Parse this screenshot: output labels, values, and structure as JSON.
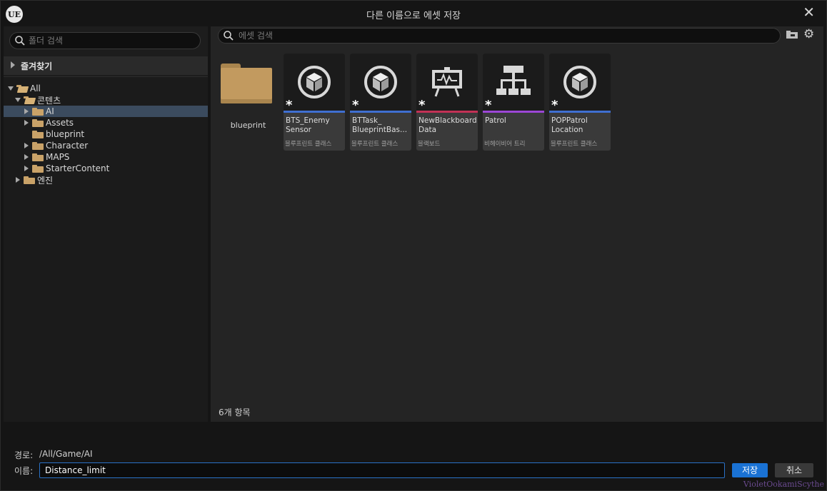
{
  "window": {
    "title": "다른 이름으로 에셋 저장",
    "logo": "UE"
  },
  "left": {
    "search_placeholder": "폴더 검색",
    "favorites_label": "즐겨찾기",
    "tree": [
      {
        "label": "All",
        "state": "open",
        "level": 0
      },
      {
        "label": "콘텐츠",
        "state": "open",
        "level": 1
      },
      {
        "label": "AI",
        "state": "closed",
        "level": 2,
        "selected": true
      },
      {
        "label": "Assets",
        "state": "closed",
        "level": 2
      },
      {
        "label": "blueprint",
        "state": "none",
        "level": 2
      },
      {
        "label": "Character",
        "state": "closed",
        "level": 2
      },
      {
        "label": "MAPS",
        "state": "closed",
        "level": 2
      },
      {
        "label": "StarterContent",
        "state": "closed",
        "level": 2
      },
      {
        "label": "엔진",
        "state": "closed",
        "level": 1
      }
    ]
  },
  "right": {
    "search_placeholder": "에셋 검색",
    "folder": {
      "name": "blueprint"
    },
    "assets": [
      {
        "name": "BTS_Enemy Sensor",
        "type": "블루프린트 클래스",
        "icon": "cube-icon",
        "stripe": "#3f6fd1"
      },
      {
        "name": "BTTask_ BlueprintBas...",
        "type": "블루프린트 클래스",
        "icon": "cube-icon",
        "stripe": "#3f6fd1"
      },
      {
        "name": "NewBlackboard Data",
        "type": "블랙보드",
        "icon": "blackboard-icon",
        "stripe": "#c23155"
      },
      {
        "name": "Patrol",
        "type": "비헤이비어 트리",
        "icon": "behavior-tree-icon",
        "stripe": "#9b46d6"
      },
      {
        "name": "POPPatrol Location",
        "type": "블루프린트 클래스",
        "icon": "cube-icon",
        "stripe": "#3f6fd1"
      }
    ],
    "item_count": "6개 항목"
  },
  "bottom": {
    "path_label": "경로:",
    "path_value": "/All/Game/AI",
    "name_label": "이름:",
    "name_value": "Distance_limit",
    "save_label": "저장",
    "cancel_label": "취소",
    "watermark": "VioletOokamiScythe"
  }
}
